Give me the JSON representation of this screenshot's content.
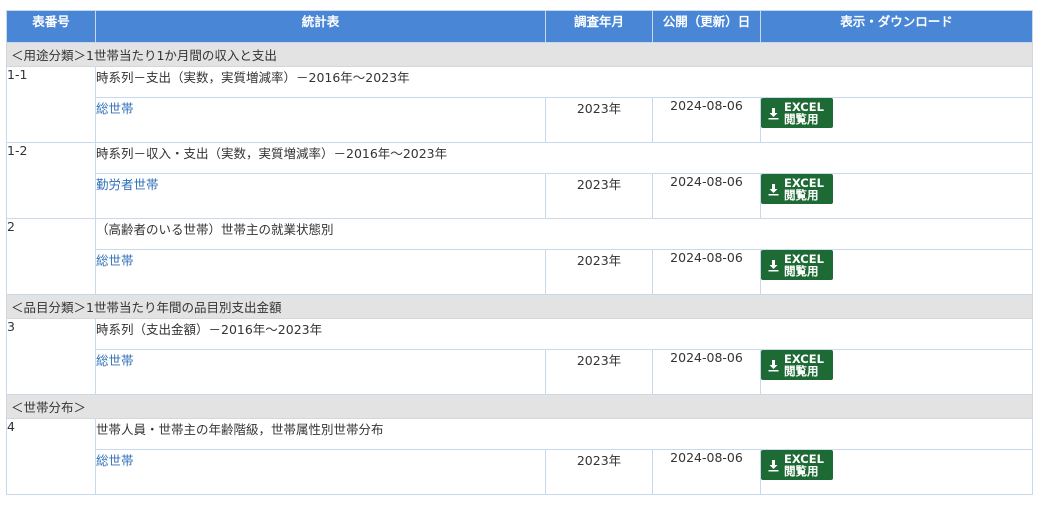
{
  "headers": {
    "number": "表番号",
    "table": "統計表",
    "survey": "調査年月",
    "published": "公開（更新）日",
    "download": "表示・ダウンロード"
  },
  "categories": [
    {
      "label": "＜用途分類＞1世帯当たり1か月間の収入と支出"
    },
    {
      "label": "＜品目分類＞1世帯当たり年間の品目別支出金額"
    },
    {
      "label": "＜世帯分布＞"
    }
  ],
  "rows": [
    {
      "num": "1-1",
      "title": "時系列－支出（実数，実質増減率）－2016年～2023年",
      "sub": "総世帯",
      "year": "2023年",
      "date": "2024-08-06",
      "btn_top": "EXCEL",
      "btn_bottom": "閲覧用"
    },
    {
      "num": "1-2",
      "title": "時系列－収入・支出（実数，実質増減率）－2016年～2023年",
      "sub": "勤労者世帯",
      "year": "2023年",
      "date": "2024-08-06",
      "btn_top": "EXCEL",
      "btn_bottom": "閲覧用"
    },
    {
      "num": "2",
      "title": "（高齢者のいる世帯）世帯主の就業状態別",
      "sub": "総世帯",
      "year": "2023年",
      "date": "2024-08-06",
      "btn_top": "EXCEL",
      "btn_bottom": "閲覧用"
    },
    {
      "num": "3",
      "title": "時系列（支出金額）－2016年～2023年",
      "sub": "総世帯",
      "year": "2023年",
      "date": "2024-08-06",
      "btn_top": "EXCEL",
      "btn_bottom": "閲覧用"
    },
    {
      "num": "4",
      "title": "世帯人員・世帯主の年齢階級，世帯属性別世帯分布",
      "sub": "総世帯",
      "year": "2023年",
      "date": "2024-08-06",
      "btn_top": "EXCEL",
      "btn_bottom": "閲覧用"
    }
  ],
  "icons": {
    "download": "download-icon"
  },
  "colors": {
    "header_bg": "#4a86d6",
    "category_bg": "#e3e3e3",
    "excel_btn": "#1e6a35",
    "link": "#2f6fb8"
  }
}
